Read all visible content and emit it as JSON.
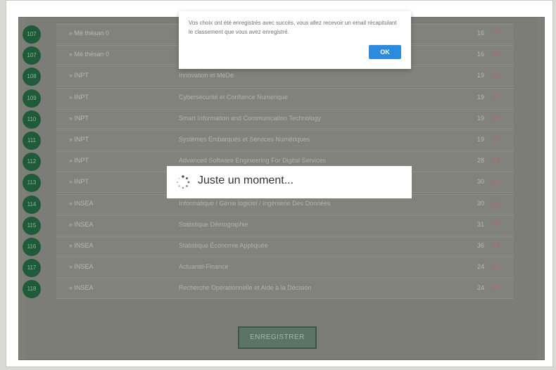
{
  "alert": {
    "message": "Vos choix ont été enregistrés avec succès, vous allez recevoir un email récapitulant le classement que vous avez enregistré.",
    "ok_label": "OK"
  },
  "loading": {
    "text": "Juste un moment..."
  },
  "rows": [
    {
      "rank": "107",
      "school": "» Mé thésan 0",
      "program": "",
      "v1": "16",
      "v2": "16"
    },
    {
      "rank": "107",
      "school": "» Mé thésan 0",
      "program": "",
      "v1": "16",
      "v2": "16"
    },
    {
      "rank": "108",
      "school": "» INPT",
      "program": "Innovation et MéDé",
      "v1": "19",
      "v2": "19"
    },
    {
      "rank": "109",
      "school": "» INPT",
      "program": "Cybersécurité et Confiance Numérique",
      "v1": "19",
      "v2": "19"
    },
    {
      "rank": "110",
      "school": "» INPT",
      "program": "Smart Information and Communication Technology",
      "v1": "19",
      "v2": "19"
    },
    {
      "rank": "111",
      "school": "» INPT",
      "program": "Systèmes Embarqués et Services Numériques",
      "v1": "19",
      "v2": "19"
    },
    {
      "rank": "112",
      "school": "» INPT",
      "program": "Advanced Software Engineering For Digital Services",
      "v1": "28",
      "v2": "28"
    },
    {
      "rank": "113",
      "school": "» INPT",
      "program": "",
      "v1": "30",
      "v2": "30"
    },
    {
      "rank": "114",
      "school": "» INSEA",
      "program": "Informatique / Génie logiciel / Ingénierie Des Données",
      "v1": "30",
      "v2": "30"
    },
    {
      "rank": "115",
      "school": "» INSEA",
      "program": "Statistique Démographie",
      "v1": "31",
      "v2": "31"
    },
    {
      "rank": "116",
      "school": "» INSEA",
      "program": "Statistique Économie Appliquée",
      "v1": "36",
      "v2": "36"
    },
    {
      "rank": "117",
      "school": "» INSEA",
      "program": "Actuariat-Finance",
      "v1": "24",
      "v2": "24"
    },
    {
      "rank": "118",
      "school": "» INSEA",
      "program": "Recherche Opérationnelle et Aide à la Décision",
      "v1": "24",
      "v2": "24"
    }
  ],
  "save_label": "ENREGISTRER"
}
